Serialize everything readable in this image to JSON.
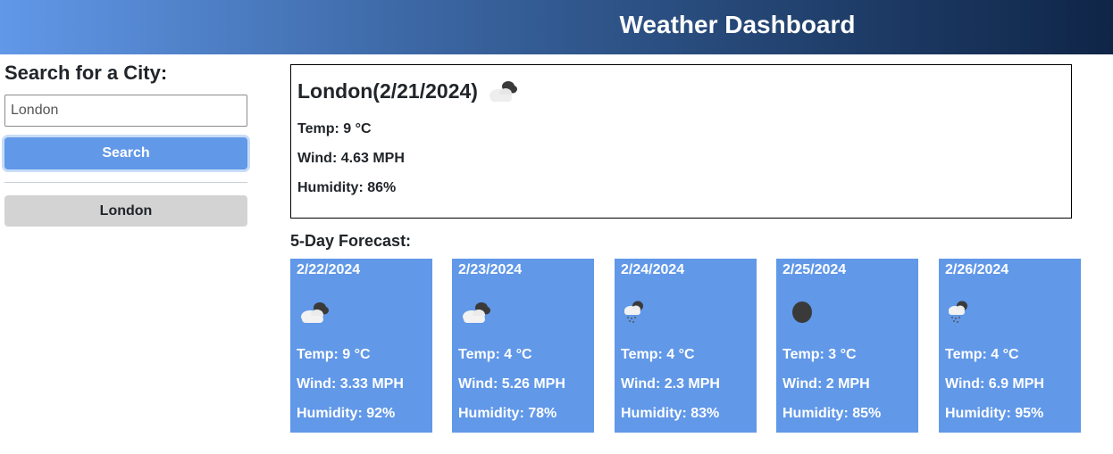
{
  "header": {
    "title": "Weather Dashboard"
  },
  "sidebar": {
    "heading": "Search for a City:",
    "search_input_value": "London",
    "search_button_label": "Search",
    "history": [
      "London"
    ]
  },
  "current": {
    "title": "London(2/21/2024)",
    "icon": "partly-cloudy-icon",
    "temp": "Temp: 9 °C",
    "wind": "Wind: 4.63 MPH",
    "humidity": "Humidity: 86%"
  },
  "forecast": {
    "heading": "5-Day Forecast:",
    "days": [
      {
        "date": "2/22/2024",
        "icon": "partly-cloudy-icon",
        "temp": "Temp: 9 °C",
        "wind": "Wind: 3.33 MPH",
        "humidity": "Humidity: 92%"
      },
      {
        "date": "2/23/2024",
        "icon": "partly-cloudy-icon",
        "temp": "Temp: 4 °C",
        "wind": "Wind: 5.26 MPH",
        "humidity": "Humidity: 78%"
      },
      {
        "date": "2/24/2024",
        "icon": "rain-cloud-icon",
        "temp": "Temp: 4 °C",
        "wind": "Wind: 2.3 MPH",
        "humidity": "Humidity: 83%"
      },
      {
        "date": "2/25/2024",
        "icon": "night-moon-icon",
        "temp": "Temp: 3 °C",
        "wind": "Wind: 2 MPH",
        "humidity": "Humidity: 85%"
      },
      {
        "date": "2/26/2024",
        "icon": "rain-cloud-icon",
        "temp": "Temp: 4 °C",
        "wind": "Wind: 6.9 MPH",
        "humidity": "Humidity: 95%"
      }
    ]
  },
  "colors": {
    "accent": "#6198e8",
    "history_button": "#d3d3d3",
    "header_gradient_start": "#6198e8",
    "header_gradient_end": "#0f2547"
  }
}
